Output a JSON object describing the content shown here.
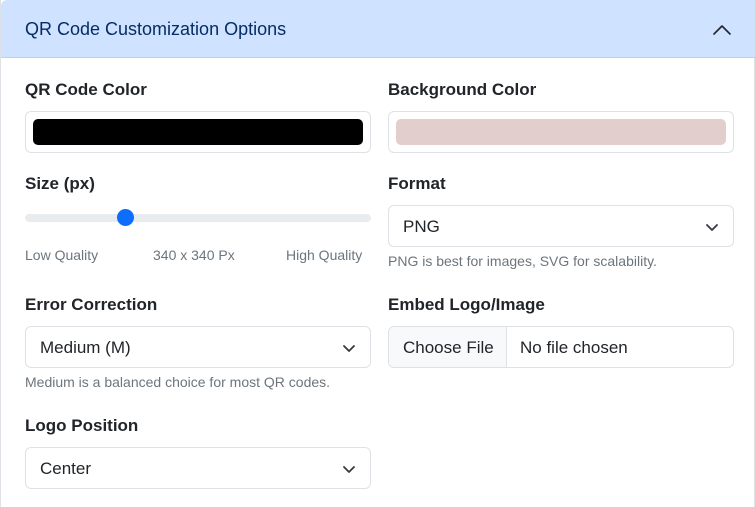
{
  "header": {
    "title": "QR Code Customization Options",
    "toggle_icon": "chevron-up-icon"
  },
  "qr_color": {
    "label": "QR Code Color",
    "value": "#000000"
  },
  "background_color": {
    "label": "Background Color",
    "value": "#e2cfcd"
  },
  "size": {
    "label": "Size (px)",
    "min_label": "Low Quality",
    "value_label": "340 x 340 Px",
    "max_label": "High Quality",
    "level_fraction": 0.28
  },
  "format": {
    "label": "Format",
    "selected": "PNG",
    "help": "PNG is best for images, SVG for scalability."
  },
  "error_correction": {
    "label": "Error Correction",
    "selected": "Medium (M)",
    "help": "Medium is a balanced choice for most QR codes."
  },
  "embed_logo": {
    "label": "Embed Logo/Image",
    "button_label": "Choose File",
    "status": "No file chosen"
  },
  "logo_position": {
    "label": "Logo Position",
    "selected": "Center"
  }
}
